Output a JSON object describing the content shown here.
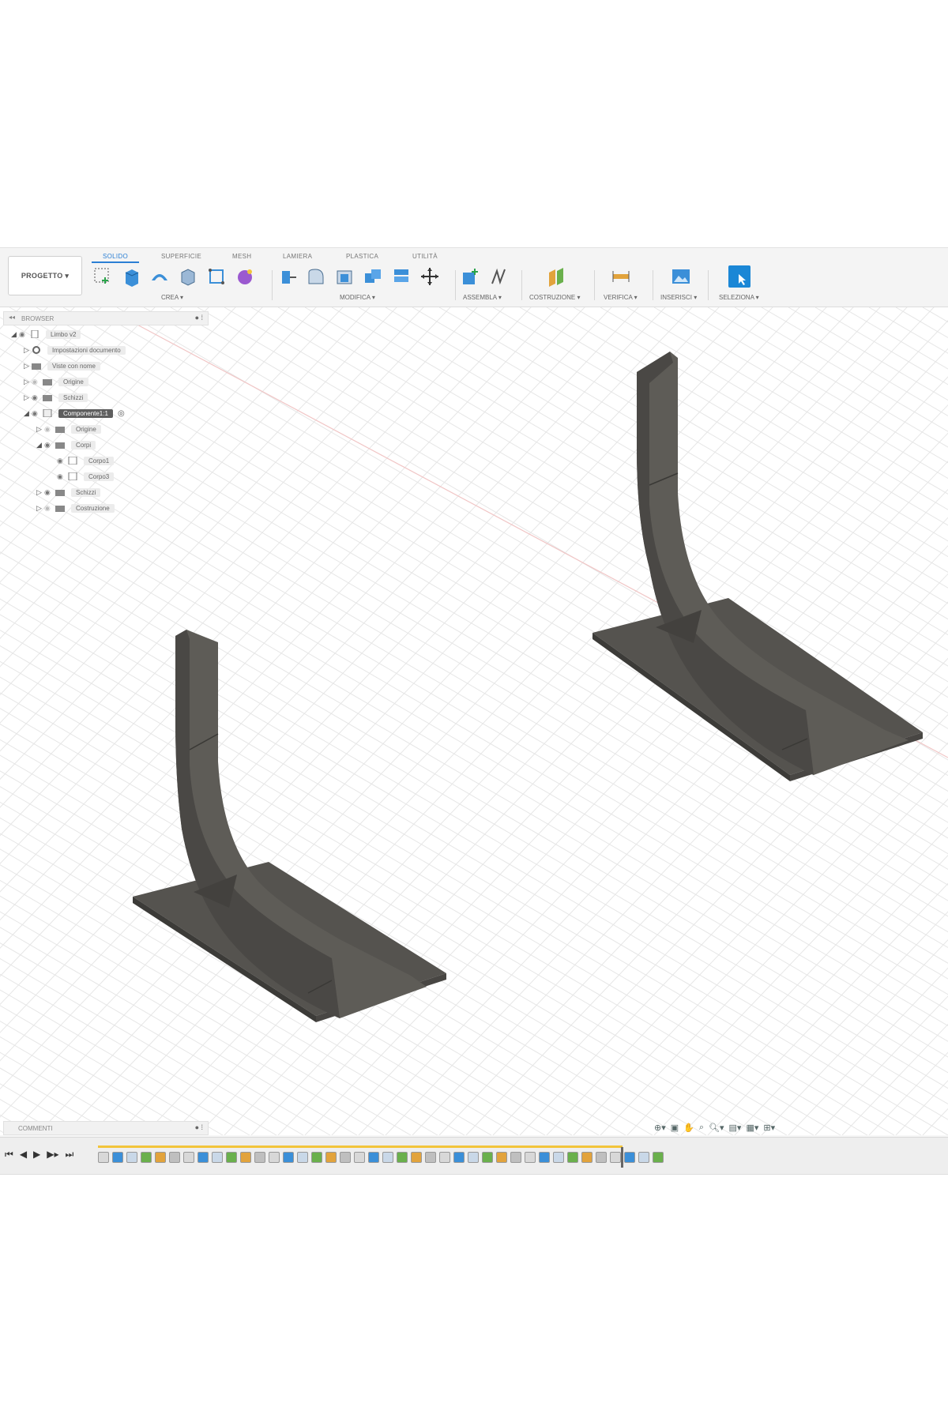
{
  "toolbar": {
    "project_button": "PROGETTO ▾",
    "tabs": [
      "SOLIDO",
      "SUPERFICIE",
      "MESH",
      "LAMIERA",
      "PLASTICA",
      "UTILITÀ"
    ],
    "groups": {
      "create": "CREA ▾",
      "modify": "MODIFICA ▾",
      "assemble": "ASSEMBLA ▾",
      "construct": "COSTRUZIONE ▾",
      "inspect": "VERIFICA ▾",
      "insert": "INSERISCI ▾",
      "select": "SELEZIONA ▾"
    }
  },
  "browser": {
    "title": "BROWSER",
    "nodes": [
      {
        "label": "Limbo v2",
        "icon": "document-icon"
      },
      {
        "label": "Impostazioni documento",
        "icon": "gear-icon"
      },
      {
        "label": "Viste con nome",
        "icon": "folder-icon"
      },
      {
        "label": "Origine",
        "icon": "folder-icon"
      },
      {
        "label": "Schizzi",
        "icon": "folder-icon"
      },
      {
        "label": "Componente1:1",
        "icon": "component-icon"
      },
      {
        "label": "Origine",
        "icon": "folder-icon"
      },
      {
        "label": "Corpi",
        "icon": "folder-icon"
      },
      {
        "label": "Corpo1",
        "icon": "body-icon"
      },
      {
        "label": "Corpo3",
        "icon": "body-icon"
      },
      {
        "label": "Schizzi",
        "icon": "folder-icon"
      },
      {
        "label": "Costruzione",
        "icon": "folder-icon"
      }
    ]
  },
  "comments": {
    "title": "COMMENTI"
  },
  "colors": {
    "accent": "#2b7fd4",
    "model": "#5c5a55",
    "timeline_bar": "#f2c43a",
    "grid_line": "#e6e6e6"
  }
}
